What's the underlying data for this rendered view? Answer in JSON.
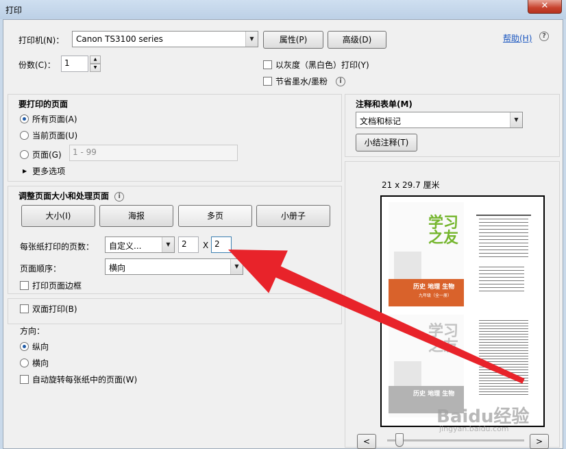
{
  "window": {
    "title": "打印",
    "close": "✕"
  },
  "printer": {
    "label": "打印机(N)：",
    "value": "Canon TS3100 series",
    "properties": "属性(P)",
    "advanced": "高级(D)",
    "help": "帮助(H)"
  },
  "copies": {
    "label": "份数(C)：",
    "value": "1"
  },
  "options": {
    "grayscale": "以灰度（黑白色）打印(Y)",
    "save_ink": "节省墨水/墨粉"
  },
  "pages": {
    "title": "要打印的页面",
    "all": "所有页面(A)",
    "current": "当前页面(U)",
    "range": "页面(G)",
    "range_value": "1 - 99",
    "more": "更多选项"
  },
  "sizing": {
    "title": "调整页面大小和处理页面",
    "buttons": [
      "大小(I)",
      "海报",
      "多页",
      "小册子"
    ],
    "pages_per_sheet_label": "每张纸打印的页数：",
    "pages_per_sheet_value": "自定义...",
    "cols": "2",
    "times": "X",
    "rows": "2",
    "order_label": "页面顺序：",
    "order_value": "横向",
    "border": "打印页面边框"
  },
  "duplex": {
    "label": "双面打印(B)"
  },
  "orientation": {
    "label": "方向：",
    "portrait": "纵向",
    "landscape": "横向",
    "auto_rotate": "自动旋转每张纸中的页面(W)"
  },
  "comments": {
    "title": "注释和表单(M)",
    "value": "文档和标记",
    "summarize": "小结注释(T)"
  },
  "preview": {
    "size": "21 x 29.7 厘米",
    "cover_title": "学习之友",
    "cover_subtitle": "历史 地理 生物",
    "cover_grade": "九年级（全一册）",
    "prev": "<",
    "next": ">"
  },
  "watermark": {
    "brand": "Baidu经验",
    "url": "jingyan.baidu.com"
  },
  "colors": {
    "accent_arrow": "#e8232a",
    "cover_orange": "#d9622b",
    "cover_green": "#74b52c"
  }
}
